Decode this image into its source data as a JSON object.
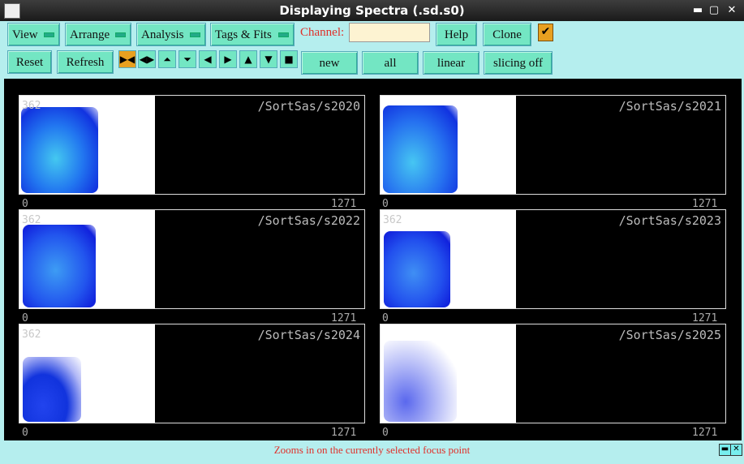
{
  "window": {
    "title": "Displaying Spectra (.sd.s0)",
    "minimize": "▬",
    "maximize": "▢",
    "close": "✕"
  },
  "toolbar": {
    "menus": [
      "View",
      "Arrange",
      "Analysis",
      "Tags & Fits"
    ],
    "channel_label": "Channel:",
    "channel_value": "",
    "help": "Help",
    "clone": "Clone",
    "check": "✔",
    "reset": "Reset",
    "refresh": "Refresh",
    "new": "new",
    "all": "all",
    "linear": "linear",
    "slicing": "slicing off"
  },
  "spectra": [
    {
      "name": "/SortSas/s2020",
      "ymax": "362",
      "xmin": "0",
      "xmax": "1271"
    },
    {
      "name": "/SortSas/s2021",
      "ymax": "",
      "xmin": "0",
      "xmax": "1271"
    },
    {
      "name": "/SortSas/s2022",
      "ymax": "362",
      "xmin": "0",
      "xmax": "1271"
    },
    {
      "name": "/SortSas/s2023",
      "ymax": "362",
      "xmin": "0",
      "xmax": "1271"
    },
    {
      "name": "/SortSas/s2024",
      "ymax": "362",
      "xmin": "0",
      "xmax": "1271"
    },
    {
      "name": "/SortSas/s2025",
      "ymax": "",
      "xmin": "0",
      "xmax": "1271"
    }
  ],
  "status": {
    "message": "Zooms in on the currently selected focus point",
    "btn1": "▬",
    "btn2": "✕"
  },
  "colors": {
    "accent": "#73e6c3",
    "background": "#b5eeee",
    "danger_text": "#e0302a"
  }
}
